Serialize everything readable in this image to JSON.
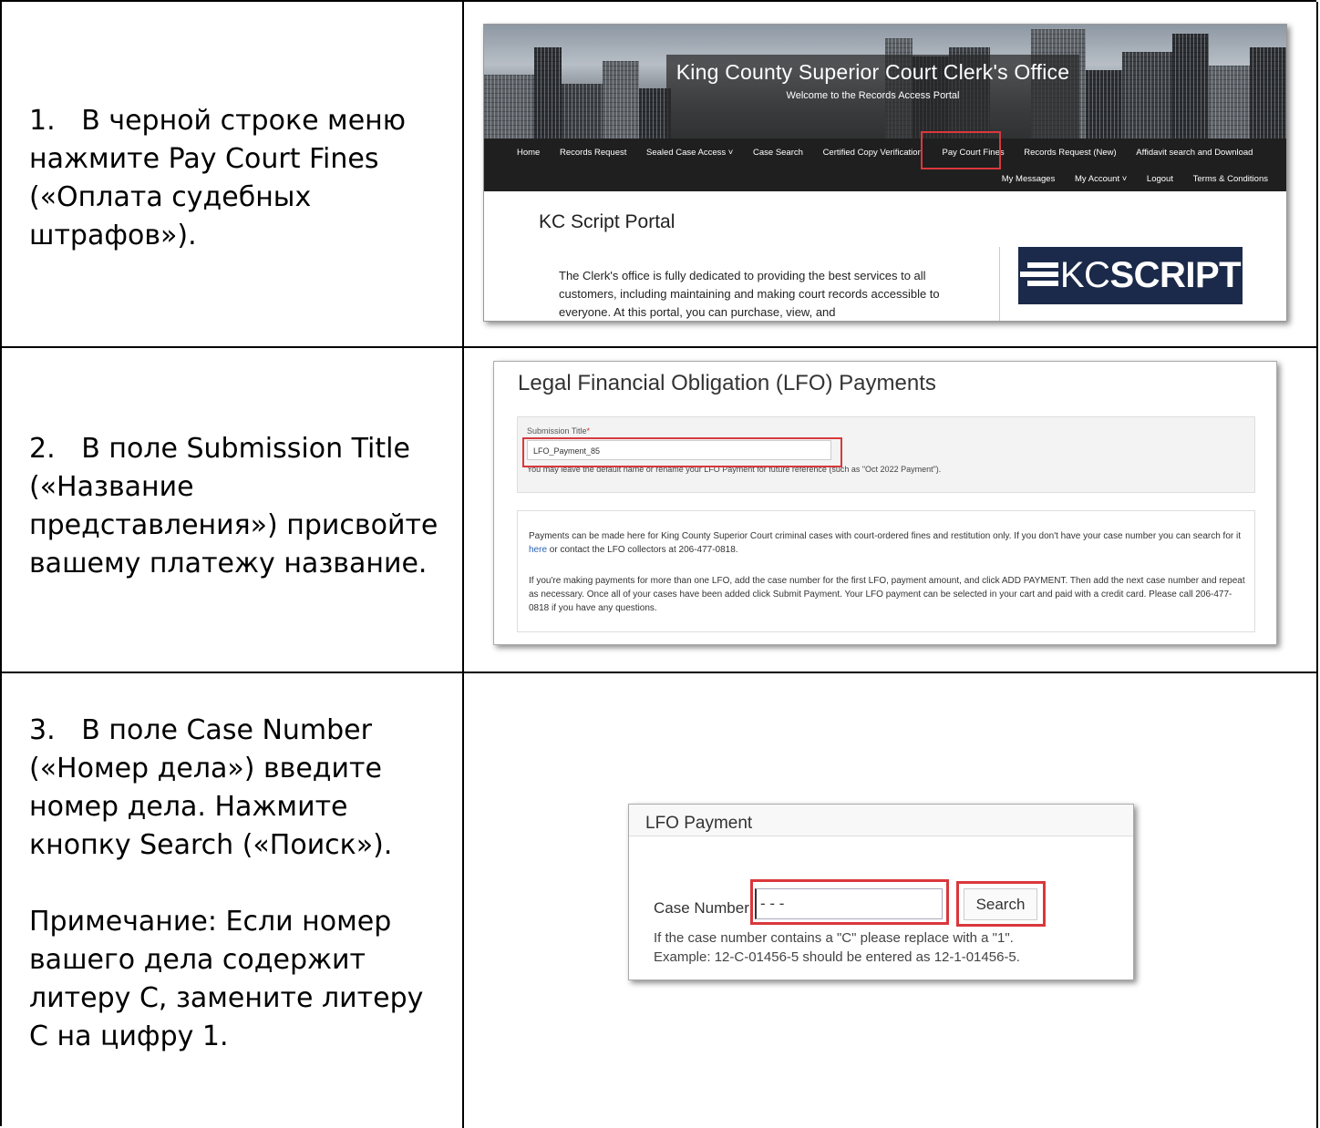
{
  "steps": [
    {
      "text": "1.   В черной строке меню нажмите Pay Court Fines («Оплата судебных штрафов»)."
    },
    {
      "text": "2.   В поле Submission Title («Название представления») присвойте вашему платежу название."
    },
    {
      "text": "3.   В поле Case Number («Номер дела») введите номер дела. Нажмите кнопку Search («Поиск»).",
      "note": "Примечание: Если номер вашего дела содержит литеру С, замените литеру С на цифру 1."
    }
  ],
  "shot1": {
    "title": "King County Superior Court Clerk's Office",
    "subtitle": "Welcome to the Records Access Portal",
    "nav_row1": [
      "Home",
      "Records Request",
      "Sealed Case Access ˅",
      "Case Search",
      "Certified Copy Verification",
      "Pay Court Fines",
      "Records Request (New)",
      "Affidavit search and Download"
    ],
    "nav_row2": [
      "My Messages",
      "My Account ˅",
      "Logout",
      "Terms & Conditions"
    ],
    "portal_title": "KC Script Portal",
    "portal_text": "The Clerk's office is fully dedicated to providing the best services to all customers, including maintaining and making court records accessible to everyone. At this portal, you can purchase, view, and",
    "logo_prefix": "KC",
    "logo_bold": "SCRIPT",
    "highlight_color": "#d9383c"
  },
  "shot2": {
    "title": "Legal Financial Obligation (LFO) Payments",
    "submission_label": "Submission Title",
    "required_mark": "*",
    "submission_value": "LFO_Payment_85",
    "submission_hint": "You may leave the default name or rename your LFO Payment for future reference (such as \"Oct 2022 Payment\").",
    "para1_start": "Payments can be made here for King County Superior Court criminal cases with court-ordered fines and restitution only. If you don't have your case number you can search for it ",
    "para1_link": "here",
    "para1_end": " or contact the LFO collectors at 206-477-0818.",
    "para2": "If you're making payments for more than one LFO, add the case number for the first LFO, payment amount, and click ADD PAYMENT. Then add the next case number and repeat as necessary. Once all of your cases have been added click Submit Payment. Your LFO payment can be selected in your cart and paid with a credit card. Please call 206-477-0818 if you have any questions."
  },
  "shot3": {
    "title": "LFO Payment",
    "case_label": "Case Number:",
    "case_value": "- -    -",
    "search_label": "Search",
    "note_line1": "If the case number contains a \"C\" please replace with a \"1\".",
    "note_line2": "Example: 12-C-01456-5 should be entered as 12-1-01456-5."
  }
}
